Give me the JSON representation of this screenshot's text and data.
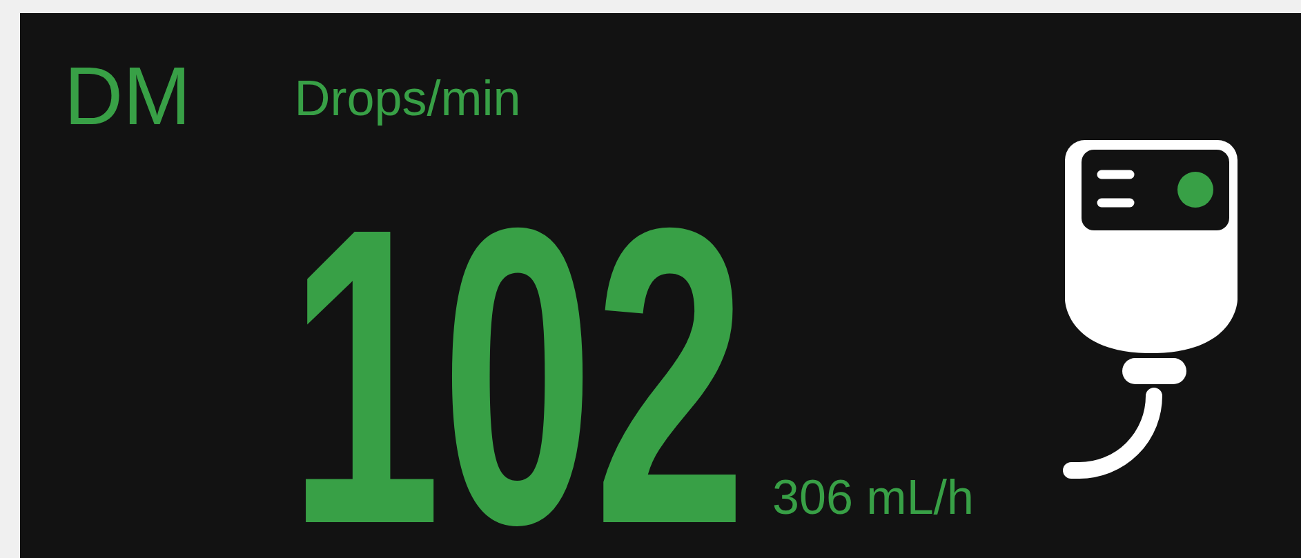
{
  "title": "DM",
  "unit": "Drops/min",
  "rate": {
    "value": "102",
    "volume_rate": "306 mL/h"
  }
}
